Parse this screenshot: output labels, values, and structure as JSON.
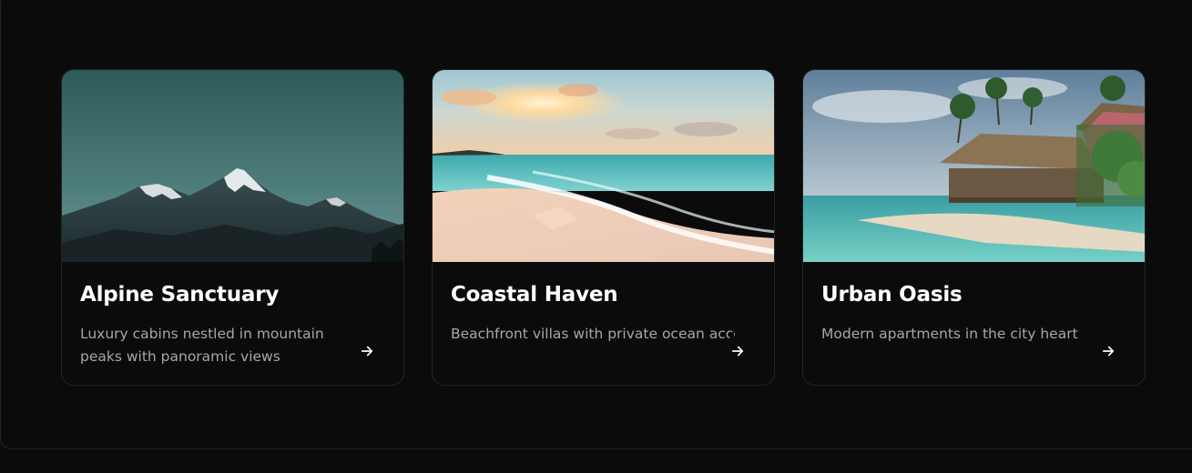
{
  "cards": [
    {
      "title": "Alpine Sanctuary",
      "description": "Luxury cabins nestled in mountain peaks with panoramic views",
      "image": "mountain-peaks-image",
      "action_icon": "arrow-right-icon"
    },
    {
      "title": "Coastal Haven",
      "description": "Beachfront villas with private ocean access",
      "image": "beach-sunset-image",
      "action_icon": "arrow-right-icon"
    },
    {
      "title": "Urban Oasis",
      "description": "Modern apartments in the city heart",
      "image": "tropical-resort-image",
      "action_icon": "arrow-right-icon"
    }
  ],
  "colors": {
    "background": "#0b0b0c",
    "card_border": "#242527",
    "title": "#ffffff",
    "description": "#a6a7ab"
  }
}
